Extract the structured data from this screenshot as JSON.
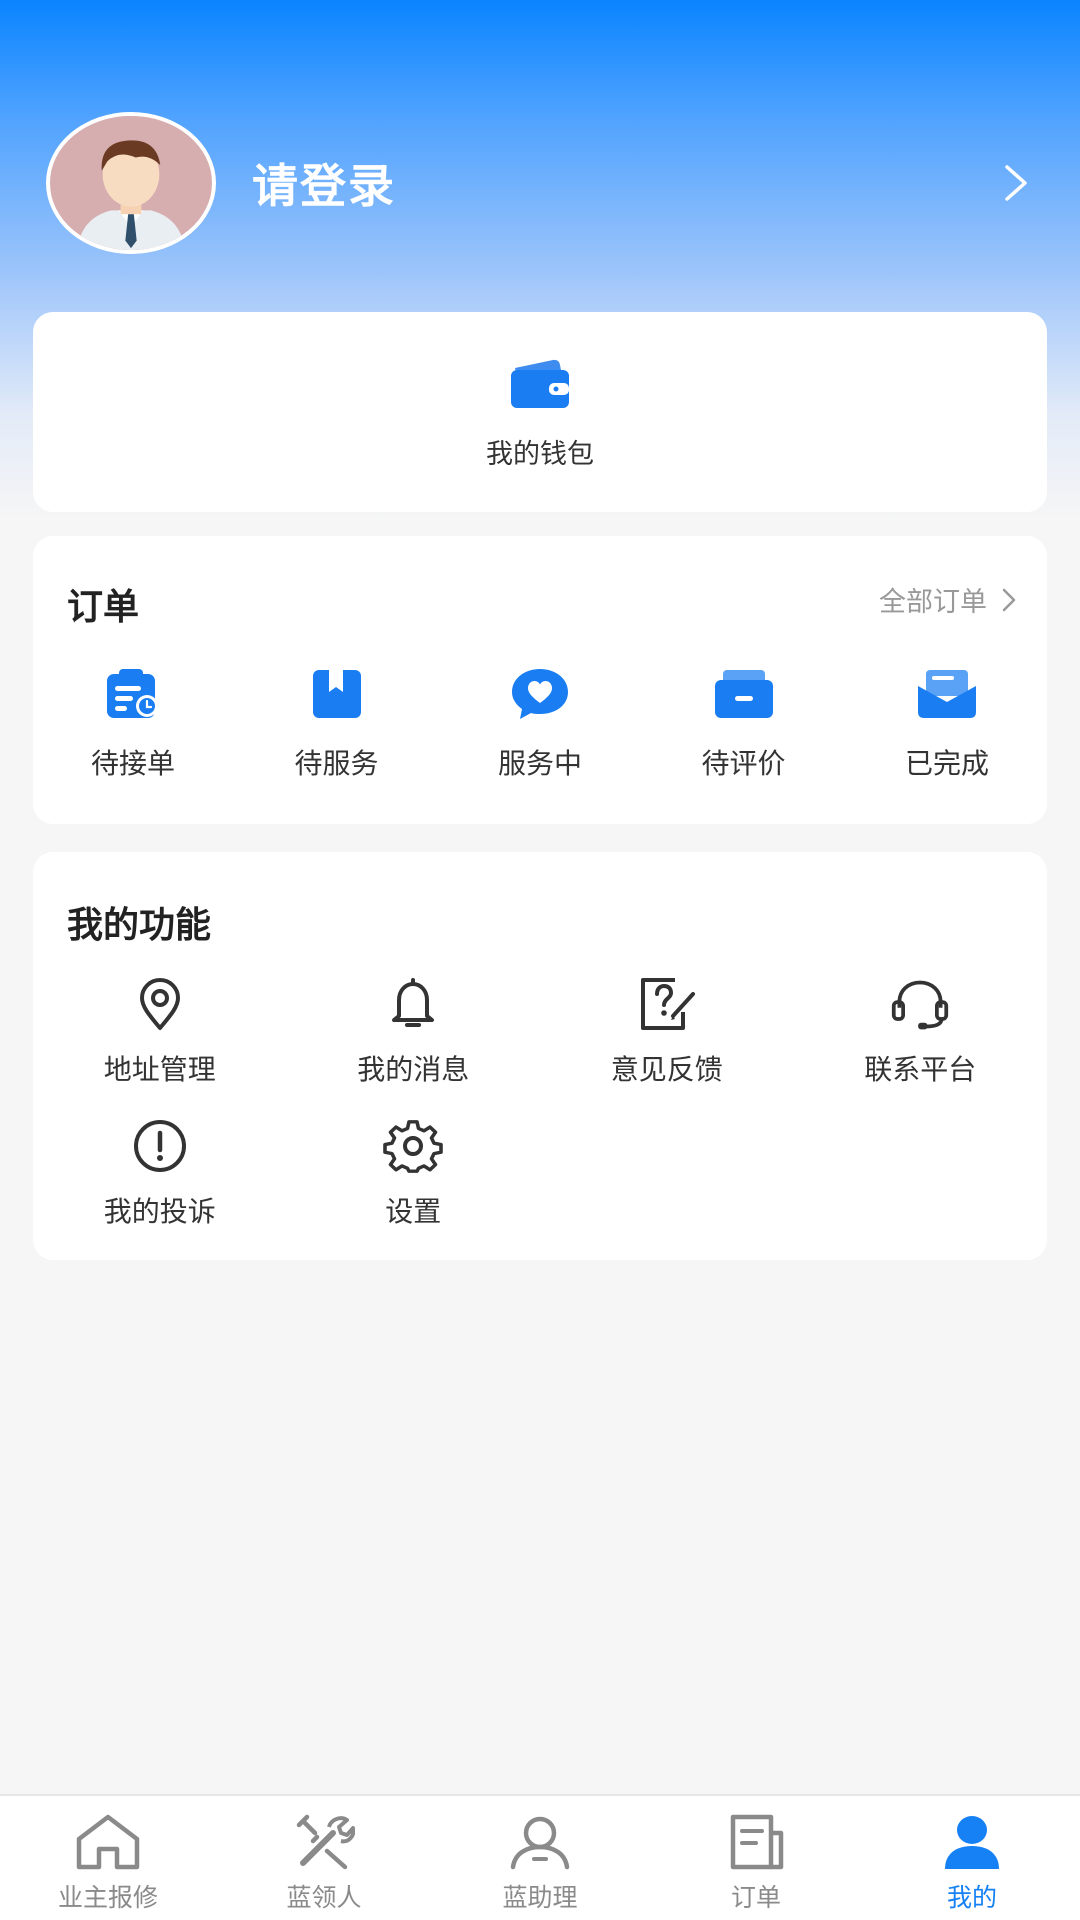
{
  "profile": {
    "login_text": "请登录"
  },
  "wallet": {
    "label": "我的钱包",
    "icon": "wallet-icon"
  },
  "orders": {
    "title": "订单",
    "all_link": "全部订单",
    "items": [
      {
        "label": "待接单",
        "icon": "pending-accept-icon"
      },
      {
        "label": "待服务",
        "icon": "pending-service-icon"
      },
      {
        "label": "服务中",
        "icon": "in-service-icon"
      },
      {
        "label": "待评价",
        "icon": "pending-review-icon"
      },
      {
        "label": "已完成",
        "icon": "completed-icon"
      }
    ]
  },
  "functions": {
    "title": "我的功能",
    "items": [
      {
        "label": "地址管理",
        "icon": "location-pin-icon"
      },
      {
        "label": "我的消息",
        "icon": "bell-icon"
      },
      {
        "label": "意见反馈",
        "icon": "feedback-icon"
      },
      {
        "label": "联系平台",
        "icon": "headset-icon"
      },
      {
        "label": "我的投诉",
        "icon": "exclamation-icon"
      },
      {
        "label": "设置",
        "icon": "gear-icon"
      }
    ]
  },
  "tabbar": {
    "items": [
      {
        "label": "业主报修",
        "icon": "house-icon"
      },
      {
        "label": "蓝领人",
        "icon": "tools-icon"
      },
      {
        "label": "蓝助理",
        "icon": "person-icon"
      },
      {
        "label": "订单",
        "icon": "order-doc-icon"
      },
      {
        "label": "我的",
        "icon": "user-filled-icon",
        "active": true
      }
    ]
  },
  "colors": {
    "primary": "#1581f5",
    "header_top": "#0a84ff",
    "text_dark": "#333333",
    "text_muted": "#999999"
  }
}
